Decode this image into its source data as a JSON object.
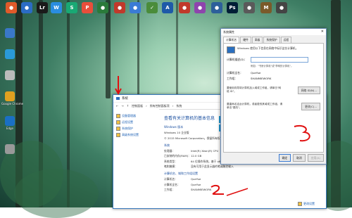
{
  "taskbar_icons": [
    {
      "name": "icon-1",
      "label": "",
      "color": "#e05a2a",
      "glyph": "●"
    },
    {
      "name": "icon-2",
      "label": "",
      "color": "#2b6cc4",
      "glyph": "●"
    },
    {
      "name": "icon-3",
      "label": "",
      "color": "#1a1a1a",
      "glyph": "Lr"
    },
    {
      "name": "icon-4",
      "label": "",
      "color": "#2a8de0",
      "glyph": "W"
    },
    {
      "name": "icon-5",
      "label": "",
      "color": "#19a974",
      "glyph": "S"
    },
    {
      "name": "icon-6",
      "label": "",
      "color": "#e84e3b",
      "glyph": "P"
    },
    {
      "name": "icon-7",
      "label": "",
      "color": "#2a7a3a",
      "glyph": "●"
    },
    {
      "name": "icon-8",
      "label": "",
      "color": "#c0392b",
      "glyph": "●"
    },
    {
      "name": "icon-9",
      "label": "",
      "color": "#3a7bd5",
      "glyph": "●"
    },
    {
      "name": "icon-10",
      "label": "",
      "color": "#4a8c3a",
      "glyph": "✓"
    },
    {
      "name": "icon-11",
      "label": "",
      "color": "#1e5aa8",
      "glyph": "A"
    },
    {
      "name": "icon-12",
      "label": "",
      "color": "#c0392b",
      "glyph": "●"
    },
    {
      "name": "icon-13",
      "label": "",
      "color": "#8e44ad",
      "glyph": "●"
    },
    {
      "name": "icon-14",
      "label": "",
      "color": "#2d5f9a",
      "glyph": "●"
    },
    {
      "name": "icon-15",
      "label": "",
      "color": "#001e36",
      "glyph": "Ps"
    },
    {
      "name": "icon-16",
      "label": "",
      "color": "#5a5a5a",
      "glyph": "●"
    },
    {
      "name": "icon-17",
      "label": "",
      "color": "#7a5a2a",
      "glyph": "M"
    },
    {
      "name": "icon-18",
      "label": "",
      "color": "#444",
      "glyph": "●"
    }
  ],
  "desktop_icons": [
    {
      "label": "",
      "color": "#3a78c8"
    },
    {
      "label": "",
      "color": "#2a9ad8"
    },
    {
      "label": "",
      "color": "#bbbbbb"
    },
    {
      "label": "Google Chrome",
      "color": "#e0a020"
    },
    {
      "label": "Edge",
      "color": "#1a6fc4"
    },
    {
      "label": "",
      "color": "#999"
    }
  ],
  "system_window": {
    "title": "系统",
    "breadcrumb": [
      "控制面板",
      "所有控制面板项",
      "系统"
    ],
    "left_links": [
      "设备管理器",
      "远程设置",
      "系统保护",
      "高级系统设置"
    ],
    "heading": "查看有关计算机的基本信息",
    "edition_label": "Windows 版本",
    "edition": [
      "Windows 10 企业版",
      "© 2015 Microsoft Corporation。保留所有权利。"
    ],
    "system_label": "系统",
    "system_rows": [
      {
        "k": "处理器：",
        "v": "Intel(R) Xeon(R) CPU"
      },
      {
        "k": "已安装的内存(RAM)：",
        "v": "12.0 GB"
      },
      {
        "k": "系统类型：",
        "v": "64 位操作系统，基于 x64 的处理器"
      },
      {
        "k": "笔和触摸：",
        "v": "没有可用于此显示器的笔或触控输入"
      }
    ],
    "computer_label": "计算机名、域和工作组设置",
    "computer_rows": [
      {
        "k": "计算机名：",
        "v": "QueYue"
      },
      {
        "k": "计算机全名：",
        "v": "QueYue"
      },
      {
        "k": "工作组：",
        "v": "SHANMIEWORK"
      }
    ],
    "change_settings_link": "更改设置"
  },
  "dialog": {
    "title": "系统属性",
    "tabs": [
      "计算机名",
      "硬件",
      "高级",
      "系统保护",
      "远程"
    ],
    "active_tab": "计算机名",
    "description": "Windows 使用以下信息在网络中标识这台计算机。",
    "field_label": "计算机描述(D)：",
    "field_value": "",
    "hint": "例如：\"书房计算机\"或\"李明的计算机\"。",
    "full_name_label": "计算机全名：",
    "full_name": "QueYue",
    "workgroup_label": "工作组：",
    "workgroup": "SHANMIEWORK",
    "network_text": "要使用向导将计算机加入域或工作组，请单击\"网络 ID\"。",
    "network_button": "网络 ID(N)...",
    "rename_text": "要重命名这台计算机，或者更改其域或工作组，请单击\"更改\"。",
    "change_button": "更改(C)...",
    "ok": "确定",
    "cancel": "取消",
    "apply": "应用(A)"
  },
  "annotations": {
    "two": "2",
    "three": "3"
  }
}
